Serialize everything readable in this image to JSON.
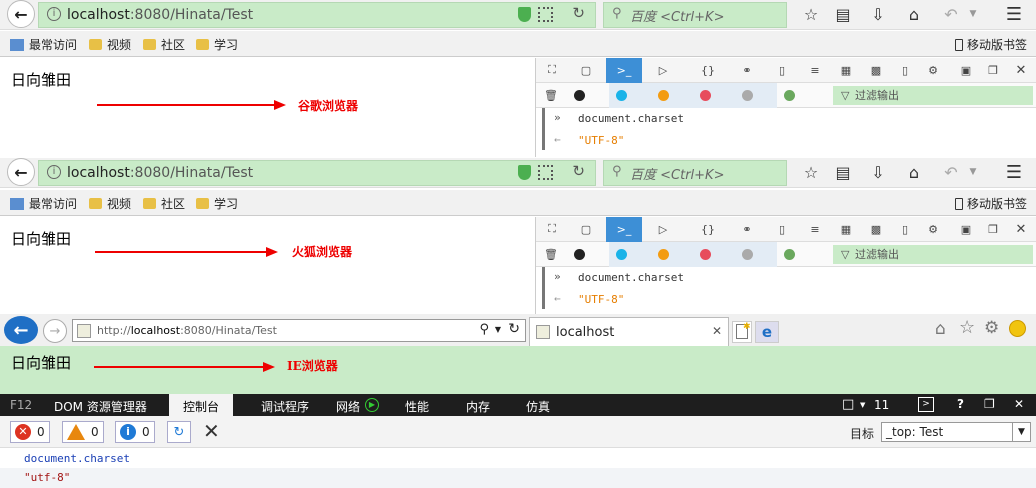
{
  "firefox1": {
    "url_host": "localhost",
    "url_rest": ":8080/Hinata/Test",
    "search_placeholder": "百度 <Ctrl+K>",
    "bookmarks": [
      "最常访问",
      "视频",
      "社区",
      "学习"
    ],
    "mobile_bookmarks": "移动版书签",
    "page_text": "日向雏田",
    "annotation": "谷歌浏览器",
    "devtools": {
      "filter_placeholder": "过滤输出",
      "console_input": "document.charset",
      "console_output": "\"UTF-8\""
    }
  },
  "firefox2": {
    "url_host": "localhost",
    "url_rest": ":8080/Hinata/Test",
    "search_placeholder": "百度 <Ctrl+K>",
    "bookmarks": [
      "最常访问",
      "视频",
      "社区",
      "学习"
    ],
    "mobile_bookmarks": "移动版书签",
    "page_text": "日向雏田",
    "annotation": "火狐浏览器",
    "devtools": {
      "filter_placeholder": "过滤输出",
      "console_input": "document.charset",
      "console_output": "\"UTF-8\""
    }
  },
  "ie": {
    "url_prefix": "http://",
    "url_host": "localhost",
    "url_rest": ":8080/Hinata/Test",
    "tab_title": "localhost",
    "page_text": "日向雏田",
    "annotation": "IE浏览器",
    "f12": {
      "label": "F12",
      "tabs": [
        "DOM 资源管理器",
        "控制台",
        "调试程序",
        "网络",
        "性能",
        "内存",
        "仿真"
      ],
      "version": "11",
      "error_count": "0",
      "warning_count": "0",
      "info_count": "0",
      "target_label": "目标",
      "target_value": "_top: Test",
      "console_input": "document.charset",
      "console_output": "\"utf-8\""
    }
  },
  "colors": {
    "url_green": "#c9ebc8",
    "devtools_blue": "#3d8fd6",
    "arrow_red": "#ee0000",
    "f12_dark": "#1e1e1e"
  }
}
